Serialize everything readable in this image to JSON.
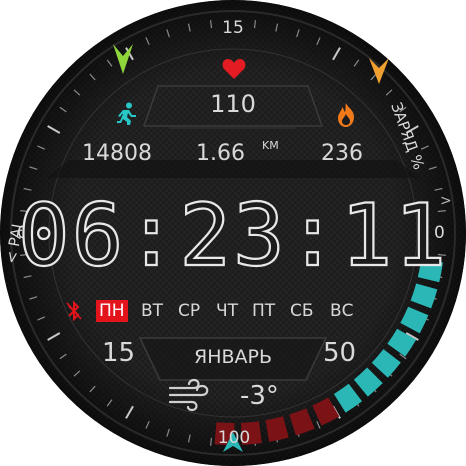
{
  "heart_rate": {
    "value": "110",
    "icon": "heart-icon",
    "color": "#e31c23"
  },
  "steps": {
    "value": "14808",
    "icon": "running-person-icon",
    "color": "#28c7c7"
  },
  "distance": {
    "value": "1.66",
    "unit": "KM"
  },
  "calories": {
    "value": "236",
    "icon": "flame-icon",
    "color": "#f07a1a"
  },
  "time": {
    "display": "06:23:11"
  },
  "week": {
    "days": [
      "ПН",
      "ВТ",
      "СР",
      "ЧТ",
      "ПТ",
      "СБ",
      "ВС"
    ],
    "active_index": 0
  },
  "date": {
    "day": "15",
    "month": "ЯНВАРЬ"
  },
  "weather": {
    "temperature": "-3°",
    "icon": "wind-icon"
  },
  "pai": {
    "label": "< PAI",
    "value": "50"
  },
  "battery": {
    "label": "ЗАРЯД %",
    "chevron": ">",
    "segments_total": 12,
    "level_fraction": 0.58
  },
  "scale_labels": {
    "top": "15",
    "left": "0",
    "right": "0",
    "bottom": "100"
  },
  "bluetooth": {
    "icon": "bluetooth-off-icon",
    "color": "#e3141c"
  },
  "colors": {
    "accent_red": "#e3141c",
    "teal": "#2ab7b5",
    "dark_red": "#7a1216",
    "green_marker": "#8fd63a",
    "orange_marker": "#f0a030"
  }
}
